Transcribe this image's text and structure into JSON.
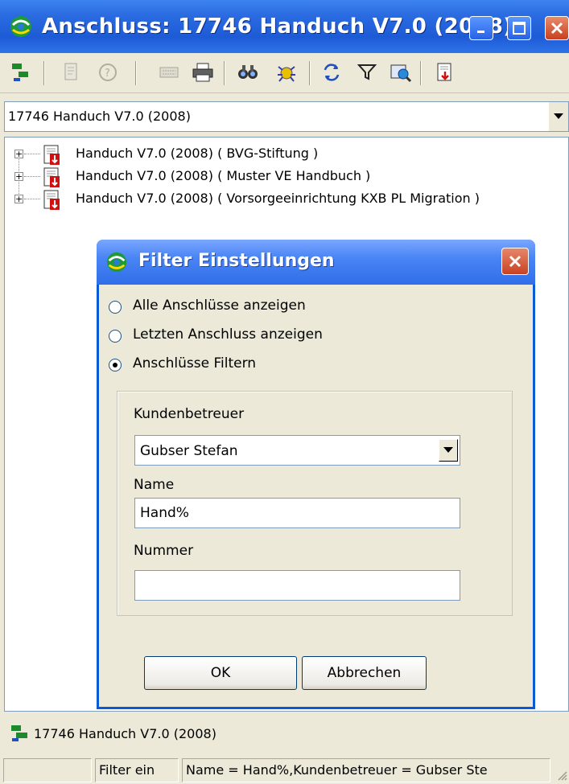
{
  "window": {
    "title": "Anschluss: 17746 Handuch V7.0 (2008)",
    "controls": [
      "minimize",
      "maximize",
      "close"
    ]
  },
  "toolbar": {
    "icons": [
      "tree-view-icon",
      "properties-icon",
      "help-icon",
      "keyboard-icon",
      "print-icon",
      "find-icon",
      "bug-search-icon",
      "refresh-icon",
      "filter-icon",
      "web-search-icon",
      "export-icon"
    ]
  },
  "selector": {
    "value": "17746 Handuch V7.0 (2008)"
  },
  "tree": {
    "items": [
      {
        "label": "Handuch V7.0 (2008) ( BVG-Stiftung )"
      },
      {
        "label": "Handuch V7.0 (2008) ( Muster VE Handbuch )"
      },
      {
        "label": "Handuch V7.0 (2008) ( Vorsorgeeinrichtung KXB PL Migration )"
      }
    ]
  },
  "dialog": {
    "title": "Filter Einstellungen",
    "options": [
      {
        "label": "Alle Anschlüsse anzeigen",
        "checked": false
      },
      {
        "label": "Letzten Anschluss anzeigen",
        "checked": false
      },
      {
        "label": "Anschlüsse Filtern",
        "checked": true
      }
    ],
    "kundenbetreuer_label": "Kundenbetreuer",
    "kundenbetreuer_value": "Gubser Stefan",
    "name_label": "Name",
    "name_value": "Hand%",
    "nummer_label": "Nummer",
    "nummer_value": "",
    "ok_label": "OK",
    "cancel_label": "Abbrechen"
  },
  "status": {
    "current": "17746 Handuch V7.0 (2008)",
    "filter_state": "Filter ein",
    "filter_details": "Name = Hand%,Kundenbetreuer = Gubser Ste"
  },
  "colors": {
    "title_bar": "#2a6be0",
    "dialog_border": "#0a5ad8",
    "window_bg": "#ece9d8",
    "close_button": "#c8401e"
  }
}
